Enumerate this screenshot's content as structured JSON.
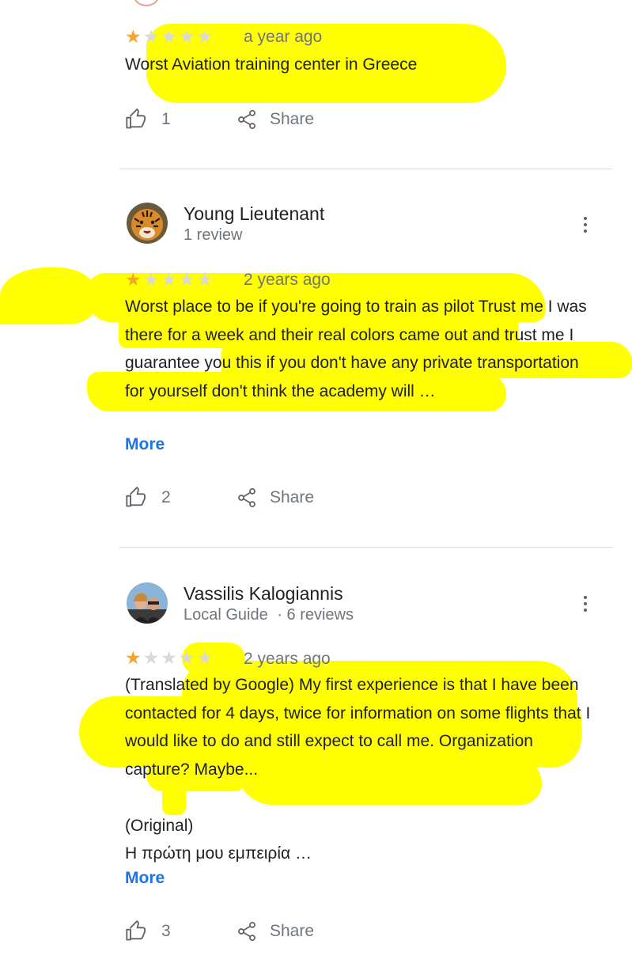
{
  "reviews": [
    {
      "stars_filled": 1,
      "stars_total": 5,
      "date": "a year ago",
      "text": "Worst Aviation training center in Greece",
      "likes": "1",
      "share_label": "Share"
    },
    {
      "author": "Young Lieutenant",
      "subtitle": "1 review",
      "stars_filled": 1,
      "stars_total": 5,
      "date": "2 years ago",
      "text": "Worst place to be if you're going to train as pilot Trust me I was there for a week and their real colors came out and trust me I guarantee you this if you don't have any private transportation for yourself don't think the academy will …",
      "more_label": "More",
      "likes": "2",
      "share_label": "Share"
    },
    {
      "author": "Vassilis Kalogiannis",
      "local_guide": "Local Guide",
      "review_count": "· 6 reviews",
      "stars_filled": 1,
      "stars_total": 5,
      "date": "2 years ago",
      "text_translated": "(Translated by Google) My first experience is that I have been contacted for 4 days, twice for information on some flights that I would like to do and still expect to call me. Organization capture? Maybe...",
      "original_label": "(Original)",
      "original_text": "Η πρώτη μου εμπειρία …",
      "more_label": "More",
      "likes": "3",
      "share_label": "Share"
    }
  ],
  "colors": {
    "star_filled": "#f4a624",
    "star_empty": "#d9d9d9",
    "link": "#1a73e8",
    "highlight": "#ffff00"
  }
}
